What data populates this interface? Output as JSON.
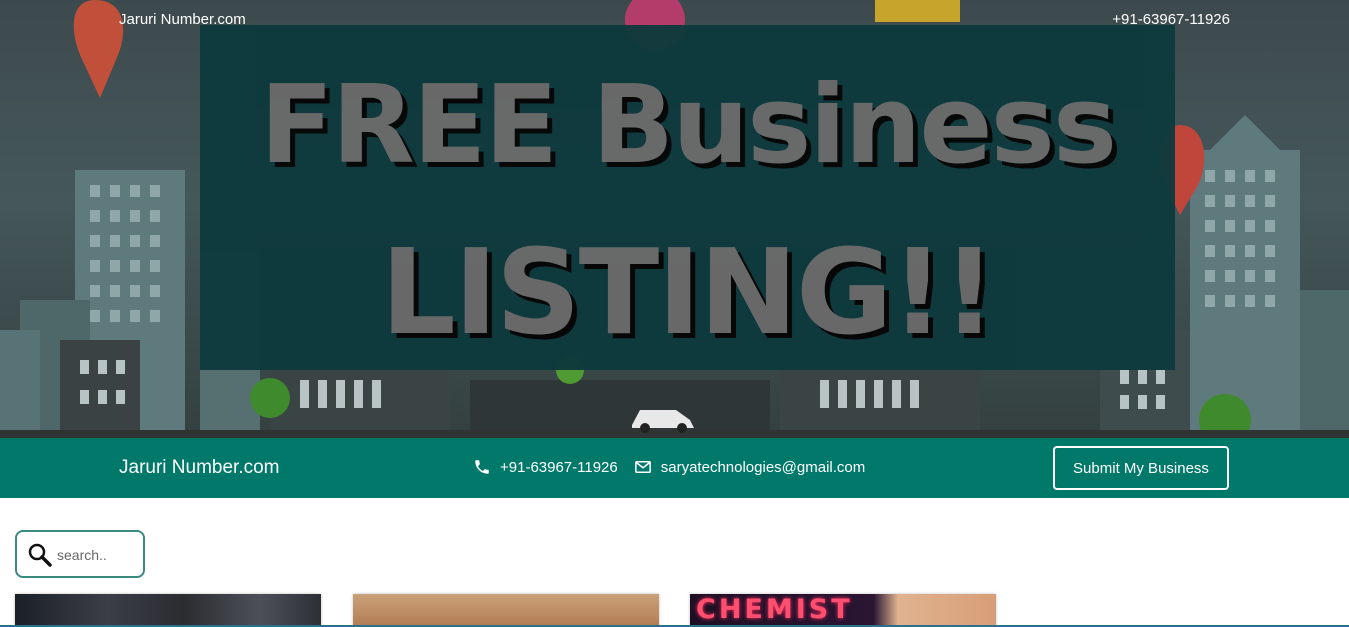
{
  "hero": {
    "brand": "Jaruri Number.com",
    "phone": "+91-63967-11926",
    "banner": {
      "line1": "FREE Business",
      "line2": "LISTING!!"
    }
  },
  "infobar": {
    "brand": "Jaruri Number.com",
    "phone": "+91-63967-11926",
    "email": "saryatechnologies@gmail.com",
    "submit_label": "Submit My Business",
    "phone_icon": "phone-icon",
    "email_icon": "envelope-icon",
    "background": "#00796b"
  },
  "search": {
    "placeholder": "search..",
    "icon": "search-icon"
  },
  "cards": [
    {
      "text": ""
    },
    {
      "text": ""
    },
    {
      "text": "CHEMIST"
    }
  ]
}
